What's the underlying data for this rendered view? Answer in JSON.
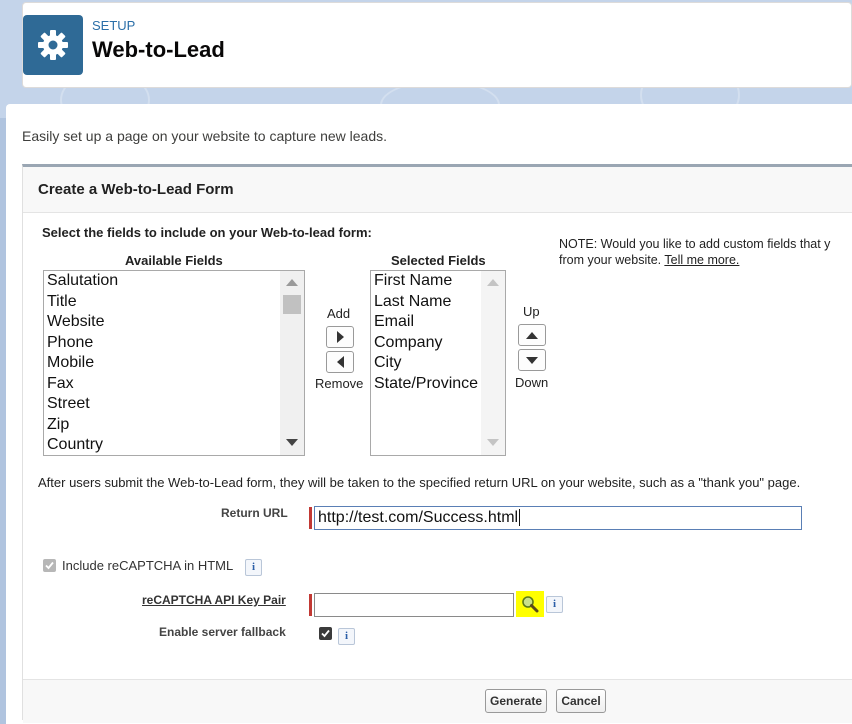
{
  "header": {
    "setup_label": "SETUP",
    "title": "Web-to-Lead"
  },
  "intro_text": "Easily set up a page on your website to capture new leads.",
  "form": {
    "title": "Create a Web-to-Lead Form",
    "select_fields_label": "Select the fields to include on your Web-to-lead form:",
    "available_label": "Available Fields",
    "selected_label": "Selected Fields",
    "available_fields": [
      "Salutation",
      "Title",
      "Website",
      "Phone",
      "Mobile",
      "Fax",
      "Street",
      "Zip",
      "Country"
    ],
    "selected_fields": [
      "First Name",
      "Last Name",
      "Email",
      "Company",
      "City",
      "State/Province"
    ],
    "add_label": "Add",
    "remove_label": "Remove",
    "up_label": "Up",
    "down_label": "Down",
    "note_line1": "NOTE: Would you like to add custom fields that y",
    "note_line2": "from your website.",
    "tell_me_more": "Tell me more.",
    "return_info": "After users submit the Web-to-Lead form, they will be taken to the specified return URL on your website, such as a \"thank you\" page.",
    "return_url_label": "Return URL",
    "return_url_value": "http://test.com/Success.html",
    "include_recaptcha_label": "Include reCAPTCHA in HTML",
    "include_recaptcha_checked": true,
    "recaptcha_key_label": "reCAPTCHA API Key Pair",
    "recaptcha_key_value": "",
    "server_fallback_label": "Enable server fallback",
    "server_fallback_checked": true,
    "info_glyph": "i"
  },
  "buttons": {
    "generate": "Generate",
    "cancel": "Cancel"
  },
  "colors": {
    "brand_icon_bg": "#2f6a96",
    "highlight": "#ffff00",
    "required": "#c23934"
  }
}
